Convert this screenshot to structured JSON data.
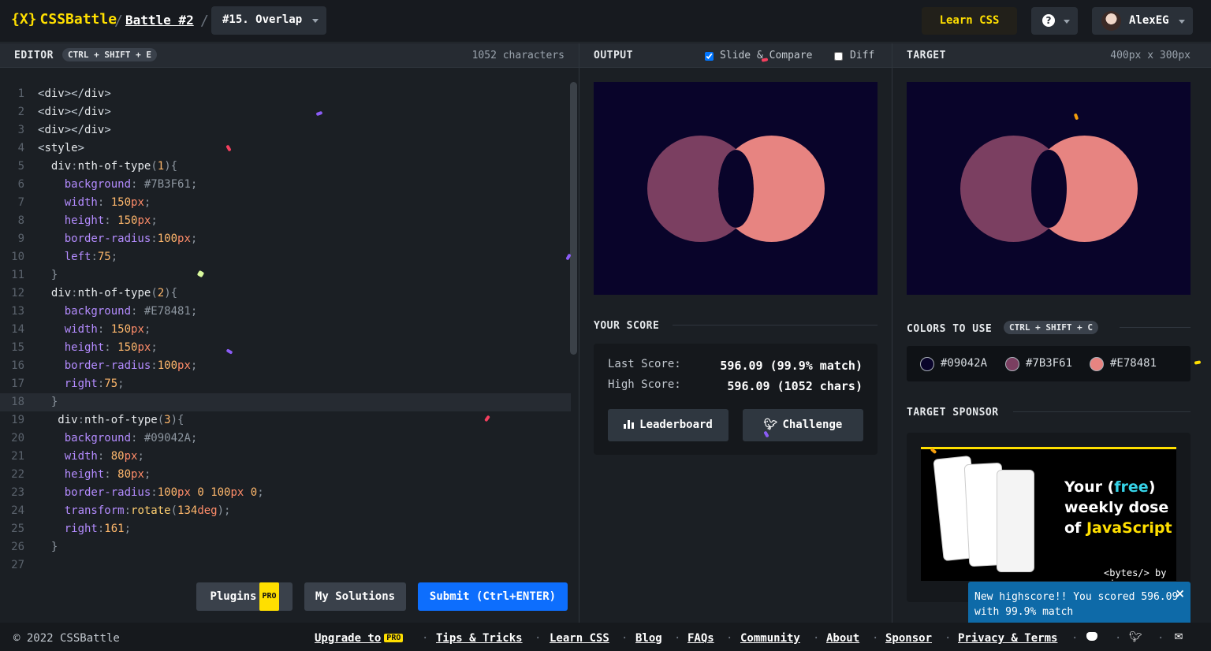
{
  "topbar": {
    "logo_mark": "{X}",
    "logo_text": "CSSBattle",
    "battle_link": "Battle #2",
    "separator": "/",
    "target_select": "#15. Overlap",
    "learn_css": "Learn CSS",
    "help_icon": "?",
    "user_name": "AlexEG"
  },
  "editor": {
    "title": "EDITOR",
    "shortcut": "CTRL + SHIFT + E",
    "char_count": "1052 characters",
    "lines": [
      {
        "n": "1",
        "parts": [
          [
            "tag",
            "<"
          ],
          [
            "tn",
            "div"
          ],
          [
            "tag",
            "></"
          ],
          [
            "tn",
            "div"
          ],
          [
            "tag",
            ">"
          ]
        ]
      },
      {
        "n": "2",
        "parts": [
          [
            "tag",
            "<"
          ],
          [
            "tn",
            "div"
          ],
          [
            "tag",
            "></"
          ],
          [
            "tn",
            "div"
          ],
          [
            "tag",
            ">"
          ]
        ]
      },
      {
        "n": "3",
        "parts": [
          [
            "tag",
            "<"
          ],
          [
            "tn",
            "div"
          ],
          [
            "tag",
            "></"
          ],
          [
            "tn",
            "div"
          ],
          [
            "tag",
            ">"
          ]
        ]
      },
      {
        "n": "4",
        "parts": [
          [
            "tag",
            "<"
          ],
          [
            "tn",
            "style"
          ],
          [
            "tag",
            ">"
          ]
        ]
      },
      {
        "n": "5",
        "parts": [
          [
            "sel",
            "  div"
          ],
          [
            "punc",
            ":"
          ],
          [
            "sel",
            "nth-of-type"
          ],
          [
            "punc",
            "("
          ],
          [
            "pc",
            "1"
          ],
          [
            "punc",
            ")"
          ],
          [
            "punc",
            "{"
          ]
        ]
      },
      {
        "n": "6",
        "parts": [
          [
            "prop",
            "    background"
          ],
          [
            "punc",
            ": "
          ],
          [
            "hex",
            "#7B3F61"
          ],
          [
            "punc",
            ";"
          ]
        ]
      },
      {
        "n": "7",
        "parts": [
          [
            "prop",
            "    width"
          ],
          [
            "punc",
            ": "
          ],
          [
            "val",
            "150"
          ],
          [
            "unit",
            "px"
          ],
          [
            "punc",
            ";"
          ]
        ]
      },
      {
        "n": "8",
        "parts": [
          [
            "prop",
            "    height"
          ],
          [
            "punc",
            ": "
          ],
          [
            "val",
            "150"
          ],
          [
            "unit",
            "px"
          ],
          [
            "punc",
            ";"
          ]
        ]
      },
      {
        "n": "9",
        "parts": [
          [
            "prop",
            "    border-radius"
          ],
          [
            "punc",
            ":"
          ],
          [
            "val",
            "100"
          ],
          [
            "unit",
            "px"
          ],
          [
            "punc",
            ";"
          ]
        ]
      },
      {
        "n": "10",
        "parts": [
          [
            "prop",
            "    left"
          ],
          [
            "punc",
            ":"
          ],
          [
            "val",
            "75"
          ],
          [
            "punc",
            ";"
          ]
        ]
      },
      {
        "n": "11",
        "parts": [
          [
            "punc",
            "  }"
          ]
        ]
      },
      {
        "n": "12",
        "parts": [
          [
            "sel",
            "  div"
          ],
          [
            "punc",
            ":"
          ],
          [
            "sel",
            "nth-of-type"
          ],
          [
            "punc",
            "("
          ],
          [
            "pc",
            "2"
          ],
          [
            "punc",
            ")"
          ],
          [
            "punc",
            "{"
          ]
        ]
      },
      {
        "n": "13",
        "parts": [
          [
            "prop",
            "    background"
          ],
          [
            "punc",
            ": "
          ],
          [
            "hex",
            "#E78481"
          ],
          [
            "punc",
            ";"
          ]
        ]
      },
      {
        "n": "14",
        "parts": [
          [
            "prop",
            "    width"
          ],
          [
            "punc",
            ": "
          ],
          [
            "val",
            "150"
          ],
          [
            "unit",
            "px"
          ],
          [
            "punc",
            ";"
          ]
        ]
      },
      {
        "n": "15",
        "parts": [
          [
            "prop",
            "    height"
          ],
          [
            "punc",
            ": "
          ],
          [
            "val",
            "150"
          ],
          [
            "unit",
            "px"
          ],
          [
            "punc",
            ";"
          ]
        ]
      },
      {
        "n": "16",
        "parts": [
          [
            "prop",
            "    border-radius"
          ],
          [
            "punc",
            ":"
          ],
          [
            "val",
            "100"
          ],
          [
            "unit",
            "px"
          ],
          [
            "punc",
            ";"
          ]
        ]
      },
      {
        "n": "17",
        "parts": [
          [
            "prop",
            "    right"
          ],
          [
            "punc",
            ":"
          ],
          [
            "val",
            "75"
          ],
          [
            "punc",
            ";"
          ]
        ]
      },
      {
        "n": "18",
        "parts": [
          [
            "punc",
            "  }"
          ]
        ]
      },
      {
        "n": "19",
        "parts": [
          [
            "sel",
            "   div"
          ],
          [
            "punc",
            ":"
          ],
          [
            "sel",
            "nth-of-type"
          ],
          [
            "punc",
            "("
          ],
          [
            "pc",
            "3"
          ],
          [
            "punc",
            ")"
          ],
          [
            "punc",
            "{"
          ]
        ]
      },
      {
        "n": "20",
        "parts": [
          [
            "prop",
            "    background"
          ],
          [
            "punc",
            ": "
          ],
          [
            "hex",
            "#09042A"
          ],
          [
            "punc",
            ";"
          ]
        ]
      },
      {
        "n": "21",
        "parts": [
          [
            "prop",
            "    width"
          ],
          [
            "punc",
            ": "
          ],
          [
            "val",
            "80"
          ],
          [
            "unit",
            "px"
          ],
          [
            "punc",
            ";"
          ]
        ]
      },
      {
        "n": "22",
        "parts": [
          [
            "prop",
            "    height"
          ],
          [
            "punc",
            ": "
          ],
          [
            "val",
            "80"
          ],
          [
            "unit",
            "px"
          ],
          [
            "punc",
            ";"
          ]
        ]
      },
      {
        "n": "23",
        "parts": [
          [
            "prop",
            "    border-radius"
          ],
          [
            "punc",
            ":"
          ],
          [
            "val",
            "100"
          ],
          [
            "unit",
            "px"
          ],
          [
            "val",
            " 0 "
          ],
          [
            "val",
            "100"
          ],
          [
            "unit",
            "px"
          ],
          [
            "val",
            " 0"
          ],
          [
            "punc",
            ";"
          ]
        ]
      },
      {
        "n": "24",
        "parts": [
          [
            "prop",
            "    transform"
          ],
          [
            "punc",
            ":"
          ],
          [
            "kw",
            "rotate"
          ],
          [
            "punc",
            "("
          ],
          [
            "val",
            "134"
          ],
          [
            "unit",
            "deg"
          ],
          [
            "punc",
            ");"
          ]
        ]
      },
      {
        "n": "25",
        "parts": [
          [
            "prop",
            "    right"
          ],
          [
            "punc",
            ":"
          ],
          [
            "val",
            "161"
          ],
          [
            "punc",
            ";"
          ]
        ]
      },
      {
        "n": "26",
        "parts": [
          [
            "punc",
            "  }"
          ]
        ]
      },
      {
        "n": "27",
        "parts": []
      }
    ],
    "active_line": 18,
    "plugins_label": "Plugins",
    "pro_badge": "PRO",
    "my_solutions_label": "My Solutions",
    "submit_label": "Submit (Ctrl+ENTER)"
  },
  "output": {
    "title": "OUTPUT",
    "slide_compare_label": "Slide & Compare",
    "slide_compare_checked": true,
    "diff_label": "Diff",
    "diff_checked": false
  },
  "score": {
    "title": "YOUR SCORE",
    "last_label": "Last Score:",
    "last_value": "596.09 (99.9% match)",
    "high_label": "High Score:",
    "high_value": "596.09 (1052 chars)",
    "leaderboard_label": "Leaderboard",
    "challenge_label": "Challenge"
  },
  "target": {
    "title": "TARGET",
    "size": "400px x 300px",
    "colors_title": "COLORS TO USE",
    "colors_shortcut": "CTRL + SHIFT + C",
    "colors": [
      "#09042A",
      "#7B3F61",
      "#E78481"
    ],
    "sponsor_title": "TARGET SPONSOR",
    "ad_line1": "Your (",
    "ad_free": "free",
    "ad_line1_end": ")",
    "ad_line2": "weekly dose",
    "ad_line3_pre": "of ",
    "ad_js": "JavaScript",
    "ad_brand": "<bytes/> by ui"
  },
  "toast": {
    "message": "New highscore!! You scored 596.09 with 99.9% match",
    "close": "×"
  },
  "footer": {
    "copyright": "© 2022 CSSBattle",
    "upgrade": "Upgrade to",
    "tips": "Tips & Tricks",
    "learn": "Learn CSS",
    "blog": "Blog",
    "faqs": "FAQs",
    "community": "Community",
    "about": "About",
    "sponsor": "Sponsor",
    "privacy": "Privacy & Terms",
    "dot": "·"
  },
  "icons": {
    "discord": "discord-icon",
    "twitter": "twitter-icon",
    "mail": "mail-icon"
  }
}
